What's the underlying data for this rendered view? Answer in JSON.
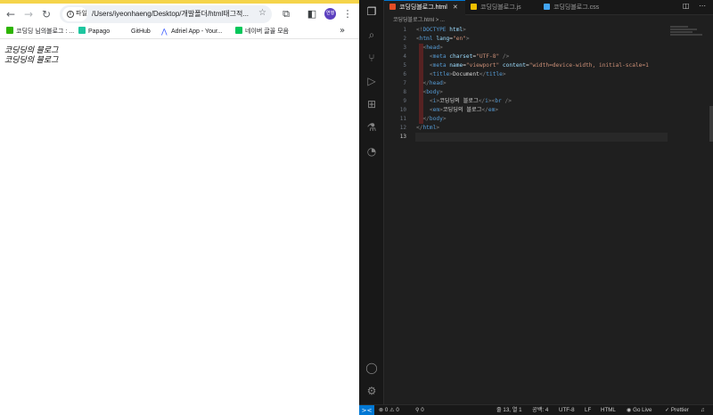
{
  "browser": {
    "url": "/Users/iyeonhaeng/Desktop/개발폴더/html태그적...",
    "site_info_label": "파일",
    "profile_initials": "연행",
    "bookmarks": [
      {
        "label": "코딩딩 님의블로그 : ...",
        "color": "#2db400"
      },
      {
        "label": "Papago",
        "color": "#1ec6a0"
      },
      {
        "label": "GitHub",
        "color": "#ffffff"
      },
      {
        "label": "Adriel App - Your...",
        "color": "#3355ff"
      },
      {
        "label": "네이버 글꼴 모음",
        "color": "#03c75a"
      }
    ],
    "page_lines": [
      "코딩딩의 블로그",
      "코딩딩의 블로그"
    ]
  },
  "vscode": {
    "tabs": [
      {
        "label": "코딩딩블로그.html",
        "color": "#e44d26",
        "active": true
      },
      {
        "label": "코딩딩블로그.js",
        "color": "#f0c000",
        "active": false
      },
      {
        "label": "코딩딩블로그.css",
        "color": "#42a5f5",
        "active": false
      }
    ],
    "breadcrumb": "코딩딩블로그.html > ...",
    "code_lines": [
      [
        {
          "c": "t-brk",
          "t": "<!"
        },
        {
          "c": "t-tag",
          "t": "DOCTYPE"
        },
        {
          "c": "t-attr",
          "t": " html"
        },
        {
          "c": "t-brk",
          "t": ">"
        }
      ],
      [
        {
          "c": "t-brk",
          "t": "<"
        },
        {
          "c": "t-tag",
          "t": "html"
        },
        {
          "c": "t-attr",
          "t": " lang"
        },
        {
          "c": "t-txt",
          "t": "="
        },
        {
          "c": "t-str",
          "t": "\"en\""
        },
        {
          "c": "t-brk",
          "t": ">"
        }
      ],
      [
        {
          "c": "t-txt",
          "t": "  "
        },
        {
          "c": "t-brk",
          "t": "<"
        },
        {
          "c": "t-tag",
          "t": "head"
        },
        {
          "c": "t-brk",
          "t": ">"
        }
      ],
      [
        {
          "c": "t-txt",
          "t": "    "
        },
        {
          "c": "t-brk",
          "t": "<"
        },
        {
          "c": "t-tag",
          "t": "meta"
        },
        {
          "c": "t-attr",
          "t": " charset"
        },
        {
          "c": "t-txt",
          "t": "="
        },
        {
          "c": "t-str",
          "t": "\"UTF-8\""
        },
        {
          "c": "t-brk",
          "t": " />"
        }
      ],
      [
        {
          "c": "t-txt",
          "t": "    "
        },
        {
          "c": "t-brk",
          "t": "<"
        },
        {
          "c": "t-tag",
          "t": "meta"
        },
        {
          "c": "t-attr",
          "t": " name"
        },
        {
          "c": "t-txt",
          "t": "="
        },
        {
          "c": "t-str",
          "t": "\"viewport\""
        },
        {
          "c": "t-attr",
          "t": " content"
        },
        {
          "c": "t-txt",
          "t": "="
        },
        {
          "c": "t-str",
          "t": "\"width=device-width, initial-scale=1"
        }
      ],
      [
        {
          "c": "t-txt",
          "t": "    "
        },
        {
          "c": "t-brk",
          "t": "<"
        },
        {
          "c": "t-tag",
          "t": "title"
        },
        {
          "c": "t-brk",
          "t": ">"
        },
        {
          "c": "t-txt",
          "t": "Document"
        },
        {
          "c": "t-brk",
          "t": "</"
        },
        {
          "c": "t-tag",
          "t": "title"
        },
        {
          "c": "t-brk",
          "t": ">"
        }
      ],
      [
        {
          "c": "t-txt",
          "t": "  "
        },
        {
          "c": "t-brk",
          "t": "</"
        },
        {
          "c": "t-tag",
          "t": "head"
        },
        {
          "c": "t-brk",
          "t": ">"
        }
      ],
      [
        {
          "c": "t-txt",
          "t": "  "
        },
        {
          "c": "t-brk",
          "t": "<"
        },
        {
          "c": "t-tag",
          "t": "body"
        },
        {
          "c": "t-brk",
          "t": ">"
        }
      ],
      [
        {
          "c": "t-txt",
          "t": "    "
        },
        {
          "c": "t-brk",
          "t": "<"
        },
        {
          "c": "t-tag",
          "t": "i"
        },
        {
          "c": "t-brk",
          "t": ">"
        },
        {
          "c": "t-txt",
          "t": "코딩딩의 블로그"
        },
        {
          "c": "t-brk",
          "t": "</"
        },
        {
          "c": "t-tag",
          "t": "i"
        },
        {
          "c": "t-brk",
          "t": "><"
        },
        {
          "c": "t-tag",
          "t": "br"
        },
        {
          "c": "t-brk",
          "t": " />"
        }
      ],
      [
        {
          "c": "t-txt",
          "t": "    "
        },
        {
          "c": "t-brk",
          "t": "<"
        },
        {
          "c": "t-tag",
          "t": "em"
        },
        {
          "c": "t-brk",
          "t": ">"
        },
        {
          "c": "t-txt",
          "t": "코딩딩의 블로그"
        },
        {
          "c": "t-brk",
          "t": "</"
        },
        {
          "c": "t-tag",
          "t": "em"
        },
        {
          "c": "t-brk",
          "t": ">"
        }
      ],
      [
        {
          "c": "t-txt",
          "t": "  "
        },
        {
          "c": "t-brk",
          "t": "</"
        },
        {
          "c": "t-tag",
          "t": "body"
        },
        {
          "c": "t-brk",
          "t": ">"
        }
      ],
      [
        {
          "c": "t-brk",
          "t": "</"
        },
        {
          "c": "t-tag",
          "t": "html"
        },
        {
          "c": "t-brk",
          "t": ">"
        }
      ],
      []
    ],
    "line_numbers": [
      "1",
      "2",
      "3",
      "4",
      "5",
      "6",
      "7",
      "8",
      "9",
      "10",
      "11",
      "12",
      "13"
    ],
    "status": {
      "remote": "><",
      "problems": "⊗ 0 ⚠ 0",
      "ports": "⚲ 0",
      "position": "줄 13, 열 1",
      "spaces": "공백: 4",
      "encoding": "UTF-8",
      "eol": "LF",
      "language": "HTML",
      "golive": "Go Live",
      "prettier": "✓ Prettier",
      "bell": "🔔"
    }
  }
}
